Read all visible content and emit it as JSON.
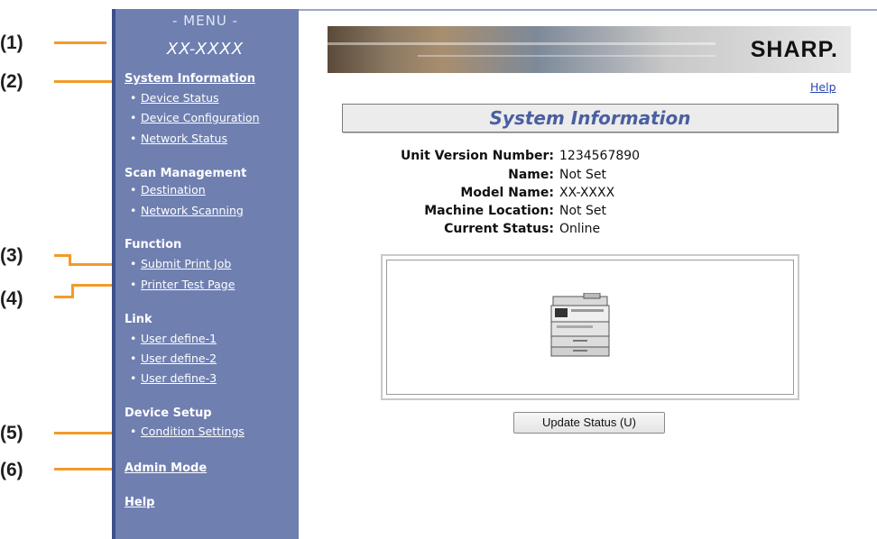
{
  "callouts": [
    "(1)",
    "(2)",
    "(3)",
    "(4)",
    "(5)",
    "(6)"
  ],
  "sidebar": {
    "menu_title": "- MENU -",
    "model": "XX-XXXX",
    "sections": [
      {
        "title": "System Information",
        "items": [
          "Device Status",
          "Device Configuration",
          "Network Status"
        ]
      },
      {
        "title": "Scan Management",
        "items": [
          "Destination",
          "Network Scanning"
        ]
      },
      {
        "title": "Function",
        "items": [
          "Submit Print Job",
          "Printer Test Page"
        ]
      },
      {
        "title": "Link",
        "items": [
          "User define-1",
          "User define-2",
          "User define-3"
        ]
      },
      {
        "title": "Device Setup",
        "items": [
          "Condition Settings"
        ]
      }
    ],
    "admin_mode": "Admin Mode",
    "help": "Help",
    "bullet": "•"
  },
  "banner": {
    "logo": "SHARP."
  },
  "main": {
    "help_link": "Help",
    "title": "System Information",
    "info": [
      {
        "label": "Unit Version Number:",
        "value": "1234567890"
      },
      {
        "label": "Name:",
        "value": "Not Set"
      },
      {
        "label": "Model Name:",
        "value": "XX-XXXX"
      },
      {
        "label": "Machine Location:",
        "value": "Not Set"
      },
      {
        "label": "Current Status:",
        "value": "Online"
      }
    ],
    "device_icon": "copier-icon",
    "update_button": "Update Status (U)"
  },
  "colors": {
    "sidebar": "#6f7fb0",
    "accent_orange": "#f39a2a",
    "title_blue": "#4a5fa0",
    "link_blue": "#2a45b0"
  }
}
